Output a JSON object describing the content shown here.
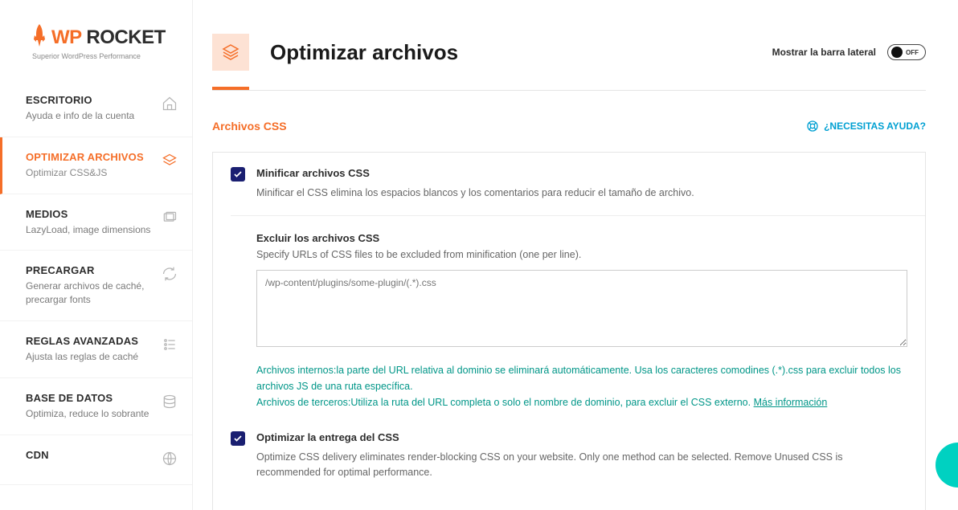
{
  "logo": {
    "brand1": "WP",
    "brand2": " ROCKET",
    "tagline": "Superior WordPress Performance"
  },
  "sidebar": {
    "items": [
      {
        "title": "ESCRITORIO",
        "sub": "Ayuda e info de la cuenta"
      },
      {
        "title": "OPTIMIZAR ARCHIVOS",
        "sub": "Optimizar CSS&JS"
      },
      {
        "title": "MEDIOS",
        "sub": "LazyLoad, image dimensions"
      },
      {
        "title": "PRECARGAR",
        "sub": "Generar archivos de caché, precargar fonts"
      },
      {
        "title": "REGLAS AVANZADAS",
        "sub": "Ajusta las reglas de caché"
      },
      {
        "title": "BASE DE DATOS",
        "sub": "Optimiza, reduce lo sobrante"
      },
      {
        "title": "CDN",
        "sub": ""
      }
    ]
  },
  "header": {
    "title": "Optimizar archivos",
    "toggle_label": "Mostrar la barra lateral",
    "toggle_state": "OFF"
  },
  "section": {
    "title": "Archivos CSS",
    "help": "¿NECESITAS AYUDA?"
  },
  "minify": {
    "title": "Minificar archivos CSS",
    "desc": "Minificar el CSS elimina los espacios blancos y los comentarios para reducir el tamaño de archivo."
  },
  "exclude": {
    "title": "Excluir los archivos CSS",
    "desc": "Specify URLs of CSS files to be excluded from minification (one per line).",
    "placeholder": "/wp-content/plugins/some-plugin/(.*).css",
    "hint1": "Archivos internos:la parte del URL relativa al dominio se eliminará automáticamente. Usa los caracteres comodines (.*).css para excluir todos los archivos JS de una ruta específica.",
    "hint2_prefix": "Archivos de terceros:Utiliza la ruta del URL completa o solo el nombre de dominio, para excluir el CSS externo. ",
    "hint2_link": "Más información"
  },
  "optimize_delivery": {
    "title": "Optimizar la entrega del CSS",
    "desc": "Optimize CSS delivery eliminates render-blocking CSS on your website. Only one method can be selected. Remove Unused CSS is recommended for optimal performance."
  }
}
